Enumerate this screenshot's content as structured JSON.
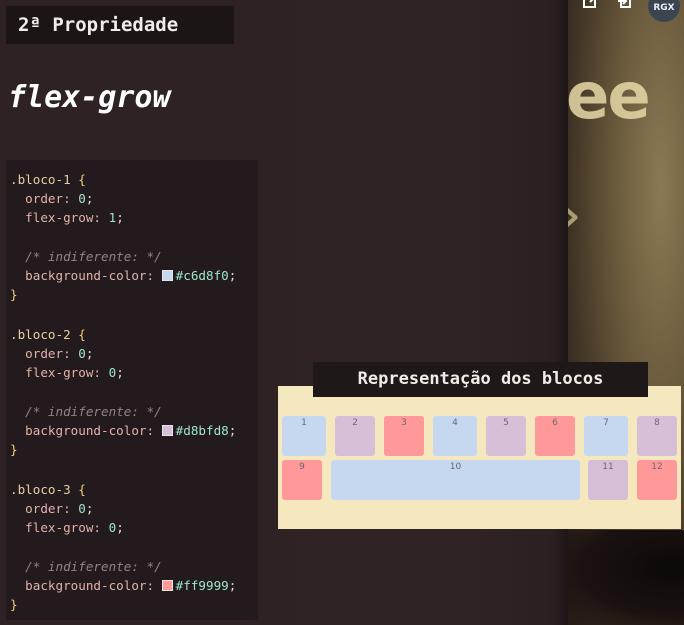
{
  "slide": {
    "title": "2ª Propriedade",
    "heading": "flex-grow"
  },
  "code": {
    "bloco1": {
      "selector": ".bloco-1",
      "order_prop": "order:",
      "order_val": "0",
      "grow_prop": "flex-grow:",
      "grow_val": "1",
      "comment": "/* indiferente: */",
      "bg_prop": "background-color:",
      "bg_val": "#c6d8f0",
      "color": "#c6d8f0"
    },
    "bloco2": {
      "selector": ".bloco-2",
      "order_prop": "order:",
      "order_val": "0",
      "grow_prop": "flex-grow:",
      "grow_val": "0",
      "comment": "/* indiferente: */",
      "bg_prop": "background-color:",
      "bg_val": "#d8bfd8",
      "color": "#d8bfd8"
    },
    "bloco3": {
      "selector": ".bloco-3",
      "order_prop": "order:",
      "order_val": "0",
      "grow_prop": "flex-grow:",
      "grow_val": "0",
      "comment": "/* indiferente: */",
      "bg_prop": "background-color:",
      "bg_val": "#ff9999",
      "color": "#ff9999"
    }
  },
  "representation": {
    "title": "Representação dos blocos",
    "blocks": [
      {
        "label": "1",
        "color": "#c6d8f0"
      },
      {
        "label": "2",
        "color": "#d8bfd8"
      },
      {
        "label": "3",
        "color": "#ff9999"
      },
      {
        "label": "4",
        "color": "#c6d8f0"
      },
      {
        "label": "5",
        "color": "#d8bfd8"
      },
      {
        "label": "6",
        "color": "#ff9999"
      },
      {
        "label": "7",
        "color": "#c6d8f0"
      },
      {
        "label": "8",
        "color": "#d8bfd8"
      },
      {
        "label": "9",
        "color": "#ff9999"
      },
      {
        "label": "10",
        "color": "#c6d8f0"
      },
      {
        "label": "11",
        "color": "#d8bfd8"
      },
      {
        "label": "12",
        "color": "#ff9999"
      }
    ]
  },
  "video": {
    "text": "ee",
    "avatar": "RGX",
    "icons": [
      "share-icon",
      "exit-icon"
    ]
  }
}
